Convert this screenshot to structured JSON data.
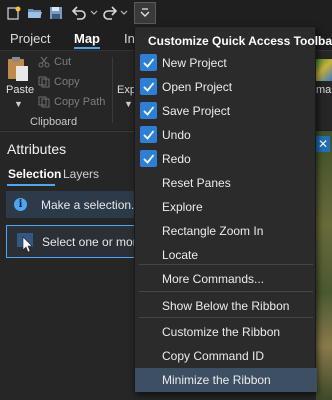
{
  "qat": {
    "buttons": [
      "new-project-icon",
      "open-project-icon",
      "save-project-icon",
      "undo-icon",
      "redo-icon",
      "customize-qat-icon"
    ]
  },
  "tabs": {
    "project": "Project",
    "map": "Map",
    "insert_peek": "In"
  },
  "ribbon": {
    "paste_label": "Paste",
    "cut_label": "Cut",
    "copy_label": "Copy",
    "copy_path_label": "Copy Path",
    "clipboard_group": "Clipboard",
    "explore_peek": "Exp",
    "map_peek": "map"
  },
  "attributes": {
    "title": "Attributes",
    "tab_selection": "Selection",
    "tab_layers": "Layers",
    "info_text": "Make a selection.",
    "select_text": "Select one or more f"
  },
  "menu": {
    "header": "Customize Quick Access Toolbar",
    "items": [
      {
        "label": "New Project",
        "checked": true
      },
      {
        "label": "Open Project",
        "checked": true
      },
      {
        "label": "Save Project",
        "checked": true
      },
      {
        "label": "Undo",
        "checked": true
      },
      {
        "label": "Redo",
        "checked": true
      },
      {
        "label": "Reset Panes",
        "checked": false
      },
      {
        "label": "Explore",
        "checked": false
      },
      {
        "label": "Rectangle Zoom In",
        "checked": false
      },
      {
        "label": "Locate",
        "checked": false
      },
      {
        "label": "More Commands...",
        "checked": false
      },
      {
        "label": "Show Below the Ribbon",
        "checked": false
      },
      {
        "label": "Customize the Ribbon",
        "checked": false
      },
      {
        "label": "Copy Command ID",
        "checked": false
      },
      {
        "label": "Minimize the Ribbon",
        "checked": false
      }
    ],
    "highlighted": "Minimize the Ribbon"
  },
  "colors": {
    "accent": "#4ea6f5",
    "check_fill": "#2f7fd4",
    "hover": "#3d4f63"
  }
}
